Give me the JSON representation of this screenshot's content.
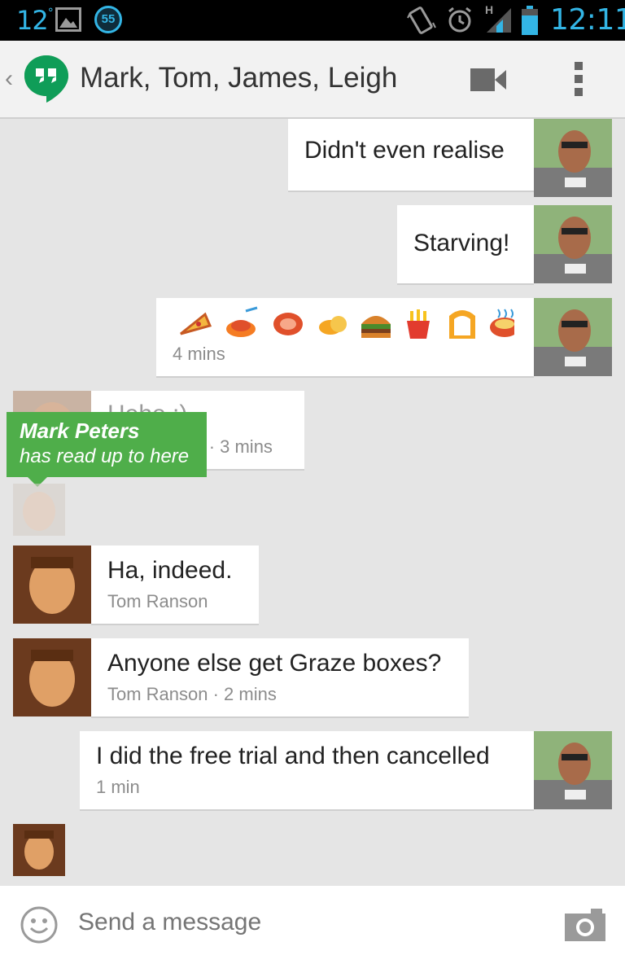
{
  "status_bar": {
    "temperature": "12",
    "temperature_unit": "°",
    "notification_count": "55",
    "time": "12:11",
    "network": "H",
    "accent_color": "#33b5e5"
  },
  "header": {
    "back_glyph": "‹",
    "title": "Mark, Tom, James, Leigh",
    "icons": [
      "hangouts-logo-icon",
      "video-call-icon",
      "overflow-menu-icon"
    ]
  },
  "messages": [
    {
      "side": "outgoing",
      "text": "Didn't even realise",
      "meta": ""
    },
    {
      "side": "outgoing",
      "text": "Starving!",
      "meta": ""
    },
    {
      "side": "outgoing",
      "emojis": [
        "pizza",
        "spaghetti",
        "meat",
        "chicken-leg",
        "hamburger",
        "fries",
        "bread",
        "ramen"
      ],
      "meta": "4 mins"
    },
    {
      "side": "incoming",
      "text": "Hehe :)",
      "meta": "Mark Peters · 3 mins",
      "sender": "Mark Peters"
    },
    {
      "side": "incoming",
      "text": "Ha, indeed.",
      "meta": "Tom Ranson",
      "sender": "Tom Ranson"
    },
    {
      "side": "incoming",
      "text": "Anyone else get Graze boxes?",
      "meta": "Tom Ranson · 2 mins",
      "sender": "Tom Ranson"
    },
    {
      "side": "outgoing",
      "text": "I did the free trial and then cancelled",
      "meta": "1 min"
    }
  ],
  "read_indicator": {
    "name": "Mark Peters",
    "subtitle": "has read up to here",
    "color": "#4fae4a"
  },
  "composer": {
    "placeholder": "Send a message",
    "icons": [
      "smiley-icon",
      "camera-icon"
    ]
  }
}
